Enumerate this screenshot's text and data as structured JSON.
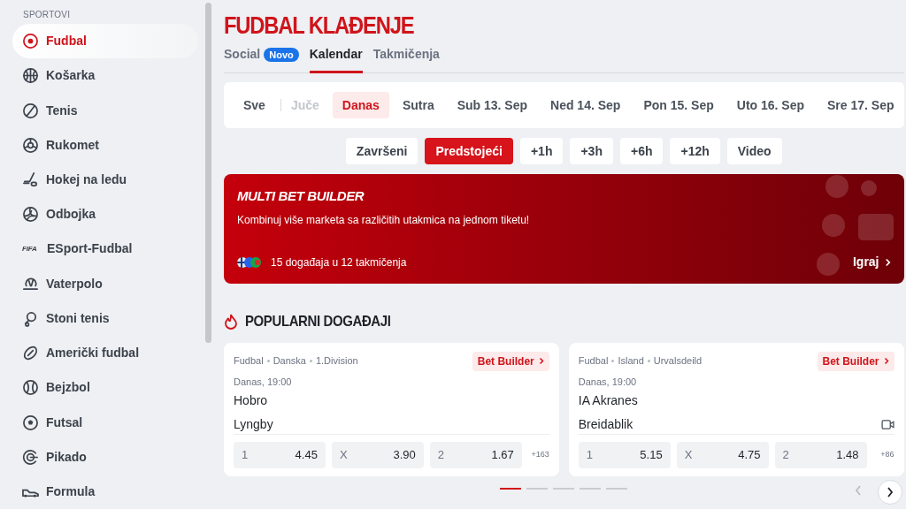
{
  "sidebar": {
    "heading": "SPORTOVI",
    "items": [
      {
        "label": "Fudbal",
        "selected": true
      },
      {
        "label": "Košarka",
        "selected": false
      },
      {
        "label": "Tenis",
        "selected": false
      },
      {
        "label": "Rukomet",
        "selected": false
      },
      {
        "label": "Hokej na ledu",
        "selected": false
      },
      {
        "label": "Odbojka",
        "selected": false
      },
      {
        "label": "ESport-Fudbal",
        "selected": false,
        "logo_text": "FIFA"
      },
      {
        "label": "Vaterpolo",
        "selected": false
      },
      {
        "label": "Stoni tenis",
        "selected": false
      },
      {
        "label": "Američki fudbal",
        "selected": false
      },
      {
        "label": "Bejzbol",
        "selected": false
      },
      {
        "label": "Futsal",
        "selected": false
      },
      {
        "label": "Pikado",
        "selected": false
      },
      {
        "label": "Formula",
        "selected": false
      }
    ]
  },
  "page_title": "FUDBAL KLAĐENJE",
  "tabs": [
    {
      "label": "Social",
      "badge": "Novo",
      "selected": false
    },
    {
      "label": "Kalendar",
      "selected": true
    },
    {
      "label": "Takmičenja",
      "selected": false
    }
  ],
  "days": [
    {
      "label": "Sve",
      "selected": false,
      "disabled": false
    },
    {
      "label": "Juče",
      "selected": false,
      "disabled": true
    },
    {
      "label": "Danas",
      "selected": true,
      "disabled": false
    },
    {
      "label": "Sutra",
      "selected": false,
      "disabled": false
    },
    {
      "label": "Sub 13. Sep",
      "selected": false,
      "disabled": false
    },
    {
      "label": "Ned 14. Sep",
      "selected": false,
      "disabled": false
    },
    {
      "label": "Pon 15. Sep",
      "selected": false,
      "disabled": false
    },
    {
      "label": "Uto 16. Sep",
      "selected": false,
      "disabled": false
    },
    {
      "label": "Sre 17. Sep",
      "selected": false,
      "disabled": false
    }
  ],
  "filters": [
    {
      "label": "Završeni",
      "selected": false
    },
    {
      "label": "Predstojeći",
      "selected": true
    },
    {
      "label": "+1h",
      "selected": false
    },
    {
      "label": "+3h",
      "selected": false
    },
    {
      "label": "+6h",
      "selected": false
    },
    {
      "label": "+12h",
      "selected": false
    },
    {
      "label": "Video",
      "selected": false
    }
  ],
  "banner": {
    "title": "MULTI BET BUILDER",
    "text": "Kombinuj više marketa sa različitih utakmica na jednom tiketu!",
    "events": "15 događaja u 12 takmičenja",
    "action": "Igraj"
  },
  "popular": {
    "title": "POPULARNI DOGAĐAJI",
    "events": [
      {
        "breadcrumb": [
          "Fudbal",
          "Danska",
          "1.Division"
        ],
        "bet_builder": "Bet Builder",
        "time": "Danas, 19:00",
        "home": "Hobro",
        "away": "Lyngby",
        "video": false,
        "odds": [
          {
            "label": "1",
            "value": "4.45"
          },
          {
            "label": "X",
            "value": "3.90"
          },
          {
            "label": "2",
            "value": "1.67"
          }
        ],
        "more": "+163"
      },
      {
        "breadcrumb": [
          "Fudbal",
          "Island",
          "Urvalsdeild"
        ],
        "bet_builder": "Bet Builder",
        "time": "Danas, 19:00",
        "home": "IA Akranes",
        "away": "Breidablik",
        "video": true,
        "odds": [
          {
            "label": "1",
            "value": "5.15"
          },
          {
            "label": "X",
            "value": "4.75"
          },
          {
            "label": "2",
            "value": "1.48"
          }
        ],
        "more": "+86"
      }
    ],
    "pages": [
      {
        "selected": true
      },
      {
        "selected": false
      },
      {
        "selected": false
      },
      {
        "selected": false
      },
      {
        "selected": false
      }
    ]
  }
}
